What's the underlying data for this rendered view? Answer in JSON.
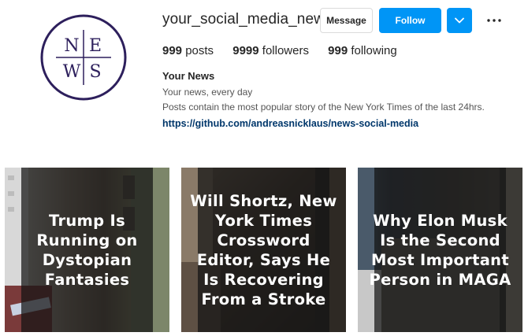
{
  "profile": {
    "avatar_letters": [
      "N",
      "E",
      "W",
      "S"
    ],
    "username": "your_social_media_news",
    "message_label": "Message",
    "follow_label": "Follow",
    "more_icon": "more-horizontal-icon",
    "dropdown_icon": "chevron-down-icon",
    "stats": {
      "posts_count": "999",
      "posts_label": "posts",
      "followers_count": "9999",
      "followers_label": "followers",
      "following_count": "999",
      "following_label": "following"
    },
    "bio": {
      "name": "Your News",
      "line1": "Your news, every day",
      "line2": "Posts contain the most popular story of the New York Times of the last 24hrs.",
      "link": "https://github.com/andreasnicklaus/news-social-media"
    }
  },
  "colors": {
    "accent": "#0095f6",
    "link": "#00376b",
    "avatar_ring": "#2d1f5c"
  },
  "posts": [
    {
      "caption": "Trump Is Running on Dystopian Fantasies"
    },
    {
      "caption": "Will Shortz, New York Times Crossword Editor, Says He Is Recovering From a Stroke"
    },
    {
      "caption": "Why Elon Musk Is the Second Most Important Person in MAGA"
    }
  ]
}
